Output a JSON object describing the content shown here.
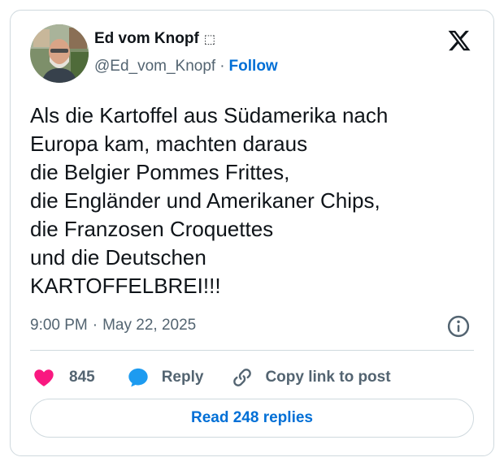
{
  "author": {
    "name": "Ed vom Knopf",
    "name_suffix": "⬚",
    "handle": "@Ed_vom_Knopf",
    "separator": "·",
    "follow_label": "Follow"
  },
  "tweet": {
    "text": "Als die Kartoffel aus Südamerika nach\nEuropa kam, machten daraus\ndie Belgier Pommes Frittes,\ndie Engländer und Amerikaner Chips,\ndie Franzosen Croquettes\nund die Deutschen\nKARTOFFELBREI!!!",
    "time": "9:00 PM",
    "separator": "·",
    "date": "May 22, 2025"
  },
  "actions": {
    "like_count": "845",
    "reply_label": "Reply",
    "copy_link_label": "Copy link to post"
  },
  "footer": {
    "read_replies_label": "Read 248 replies"
  },
  "icons": {
    "brand": "x-logo-icon",
    "info": "info-icon",
    "like": "heart-icon",
    "reply": "speech-bubble-icon",
    "copy": "link-icon"
  },
  "colors": {
    "follow": "#006fd6",
    "like": "#f91880",
    "reply": "#1d9bf0",
    "muted": "#536471",
    "border": "#cfd9de"
  }
}
